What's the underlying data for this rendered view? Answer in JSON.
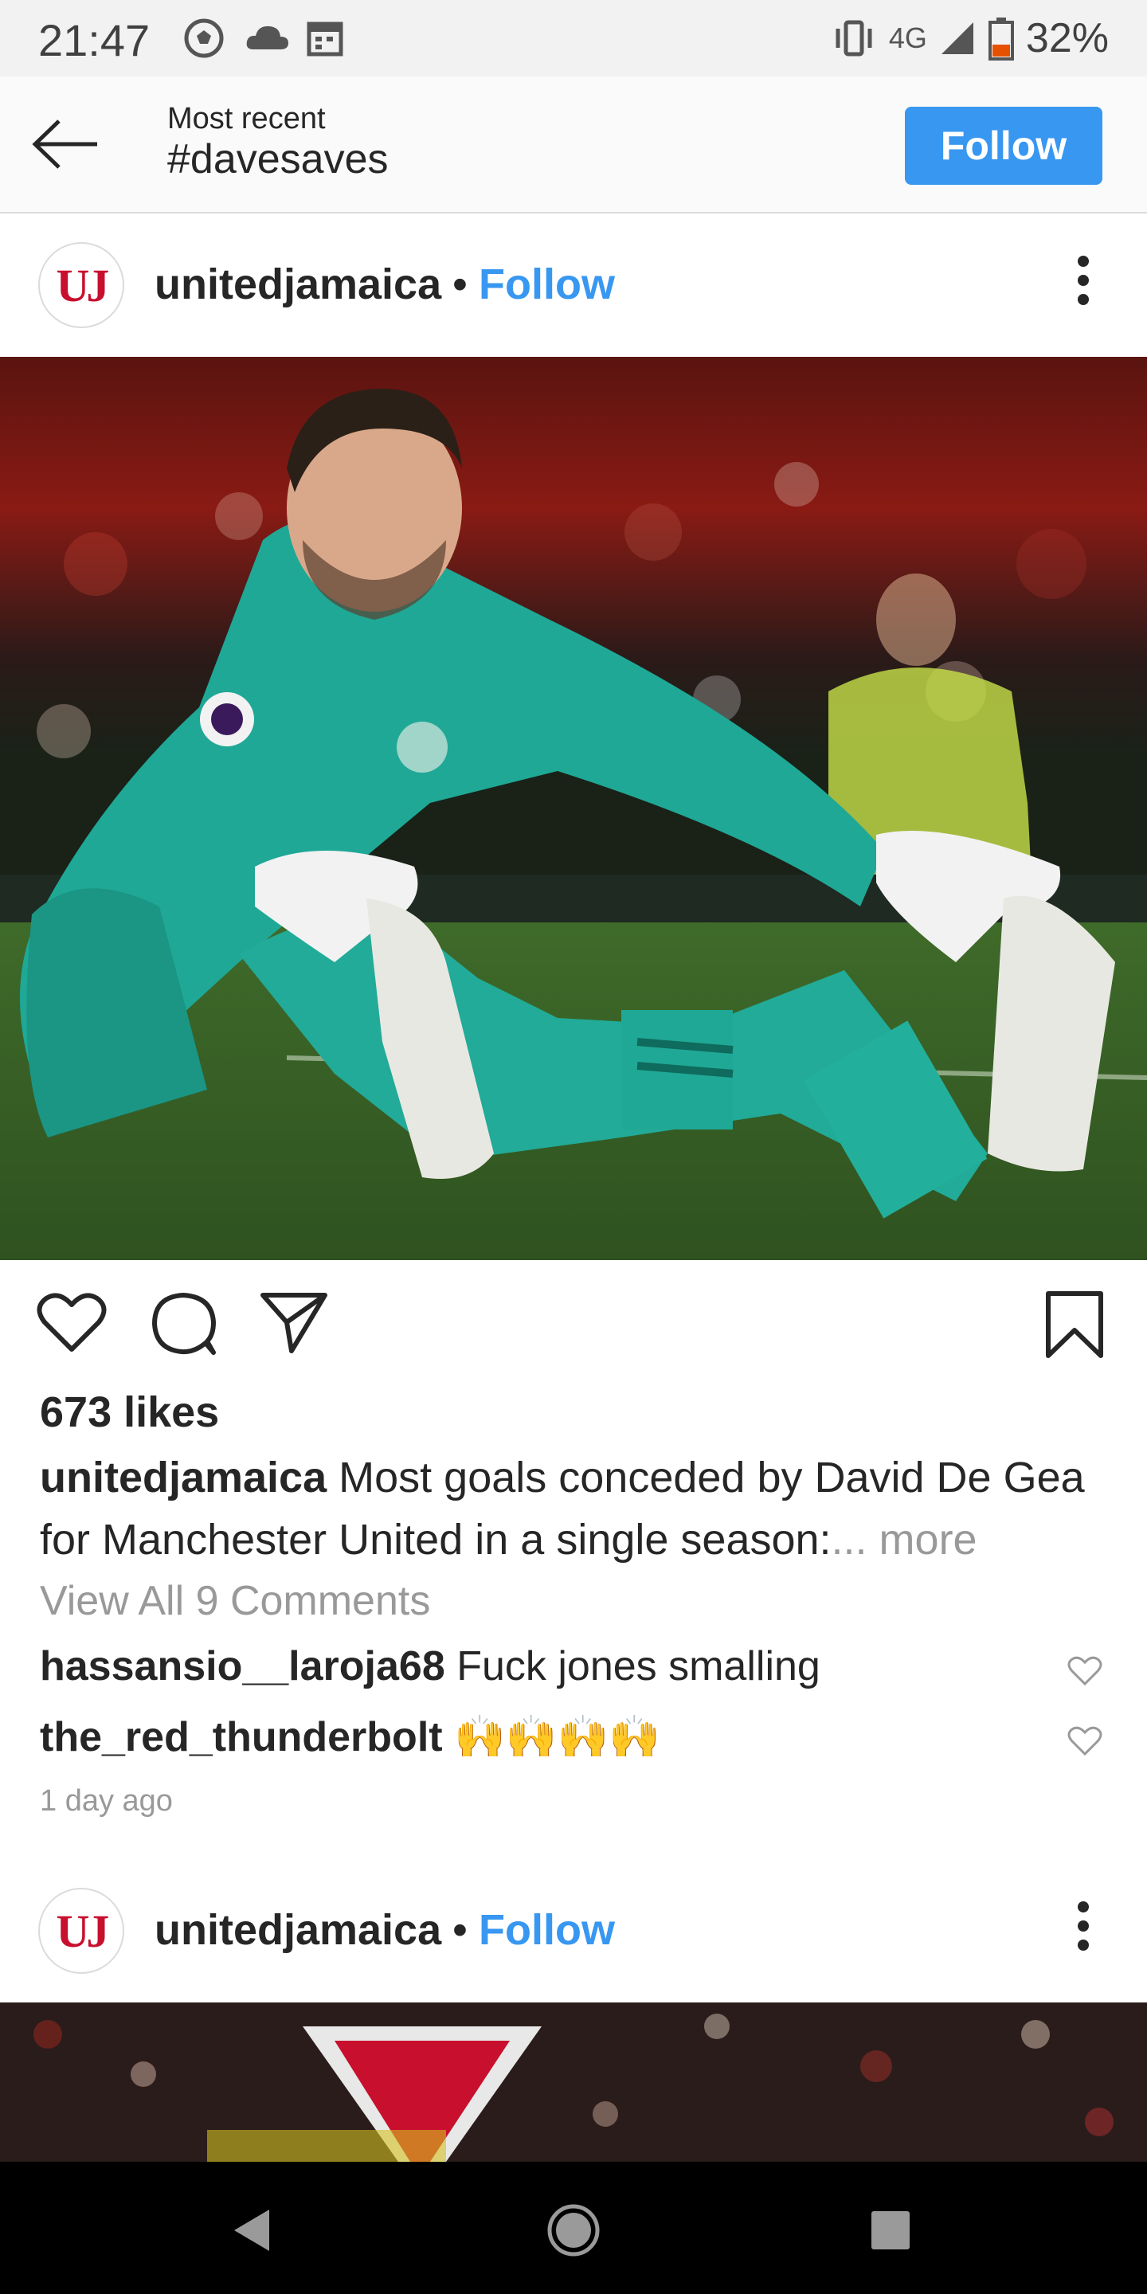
{
  "status_bar": {
    "time": "21:47",
    "network": "4G",
    "battery": "32%",
    "icons": [
      "soccer-ball-icon",
      "cloud-icon",
      "calendar-icon",
      "vibrate-icon",
      "signal-icon",
      "battery-icon"
    ]
  },
  "header": {
    "subtitle": "Most recent",
    "title": "#davesaves",
    "follow_label": "Follow"
  },
  "posts": [
    {
      "avatar_text": "UJ",
      "username": "unitedjamaica",
      "separator": "•",
      "follow_label": "Follow",
      "likes": "673 likes",
      "caption_user": "unitedjamaica",
      "caption_text": "Most goals conceded by David De Gea for Manchester United in a single season:",
      "caption_more": "... more",
      "view_all": "View All 9 Comments",
      "comments": [
        {
          "user": "hassansio__laroja68",
          "text": "Fuck jones smalling"
        },
        {
          "user": "the_red_thunderbolt",
          "text": "🙌🙌🙌🙌"
        }
      ],
      "time_ago": "1 day ago"
    },
    {
      "avatar_text": "UJ",
      "username": "unitedjamaica",
      "separator": "•",
      "follow_label": "Follow"
    }
  ],
  "colors": {
    "accent": "#3897f0",
    "brand_red": "#c8102e",
    "kit": "#1fa896"
  }
}
